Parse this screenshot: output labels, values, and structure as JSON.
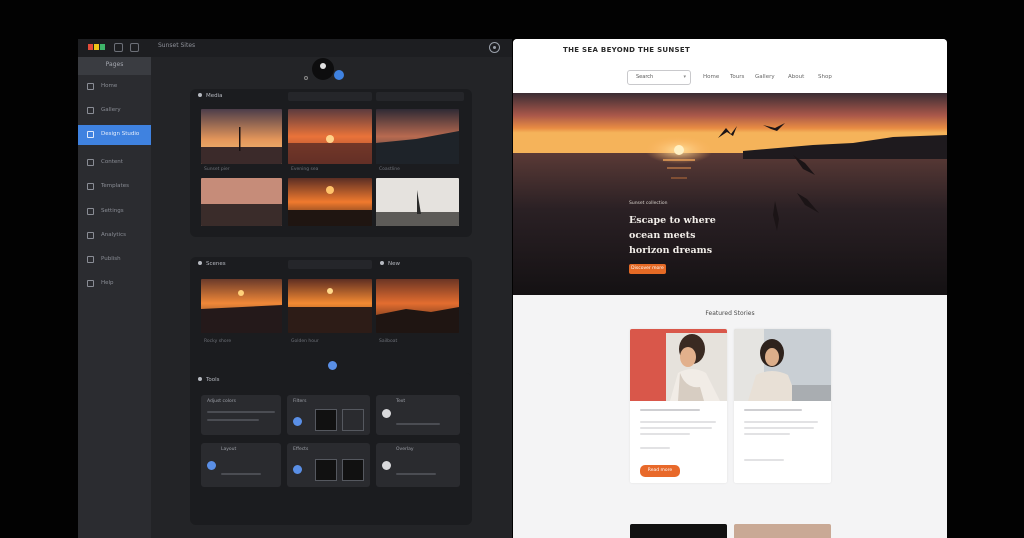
{
  "editor": {
    "title": "Sunset Sites",
    "sidebar_header": "Pages",
    "sidebar_items": [
      {
        "label": "Home",
        "active": false
      },
      {
        "label": "Gallery",
        "active": false
      },
      {
        "label": "Design Studio",
        "active": true
      },
      {
        "label": "Content",
        "active": false
      },
      {
        "label": "Templates",
        "active": false
      },
      {
        "label": "Settings",
        "active": false
      },
      {
        "label": "Analytics",
        "active": false
      },
      {
        "label": "Publish",
        "active": false
      },
      {
        "label": "Help",
        "active": false
      }
    ],
    "panels": [
      {
        "title": "Media"
      },
      {
        "title": "Scenes",
        "tab_label": "New"
      },
      {
        "title": "Tools"
      }
    ],
    "captions": [
      "Sunset pier",
      "Evening sea",
      "Coastline",
      "Rocky shore",
      "Golden hour",
      "Sailboat"
    ],
    "tool_cards": [
      {
        "title": "Adjust colors"
      },
      {
        "title": "Filters"
      },
      {
        "title": "Text"
      },
      {
        "title": "Layout"
      },
      {
        "title": "Effects"
      },
      {
        "title": "Overlay"
      }
    ]
  },
  "site": {
    "brand": "THE SEA BEYOND THE SUNSET",
    "search_label": "Search",
    "nav": [
      "Home",
      "Tours",
      "Gallery",
      "About",
      "Shop"
    ],
    "hero": {
      "kicker": "Sunset collection",
      "lines": [
        "Escape to where",
        "ocean meets",
        "horizon dreams"
      ],
      "cta": "Discover more"
    },
    "section_title": "Featured Stories",
    "card_cta": "Read more"
  },
  "colors": {
    "accent": "#3f82e0",
    "cta": "#e56a25"
  }
}
